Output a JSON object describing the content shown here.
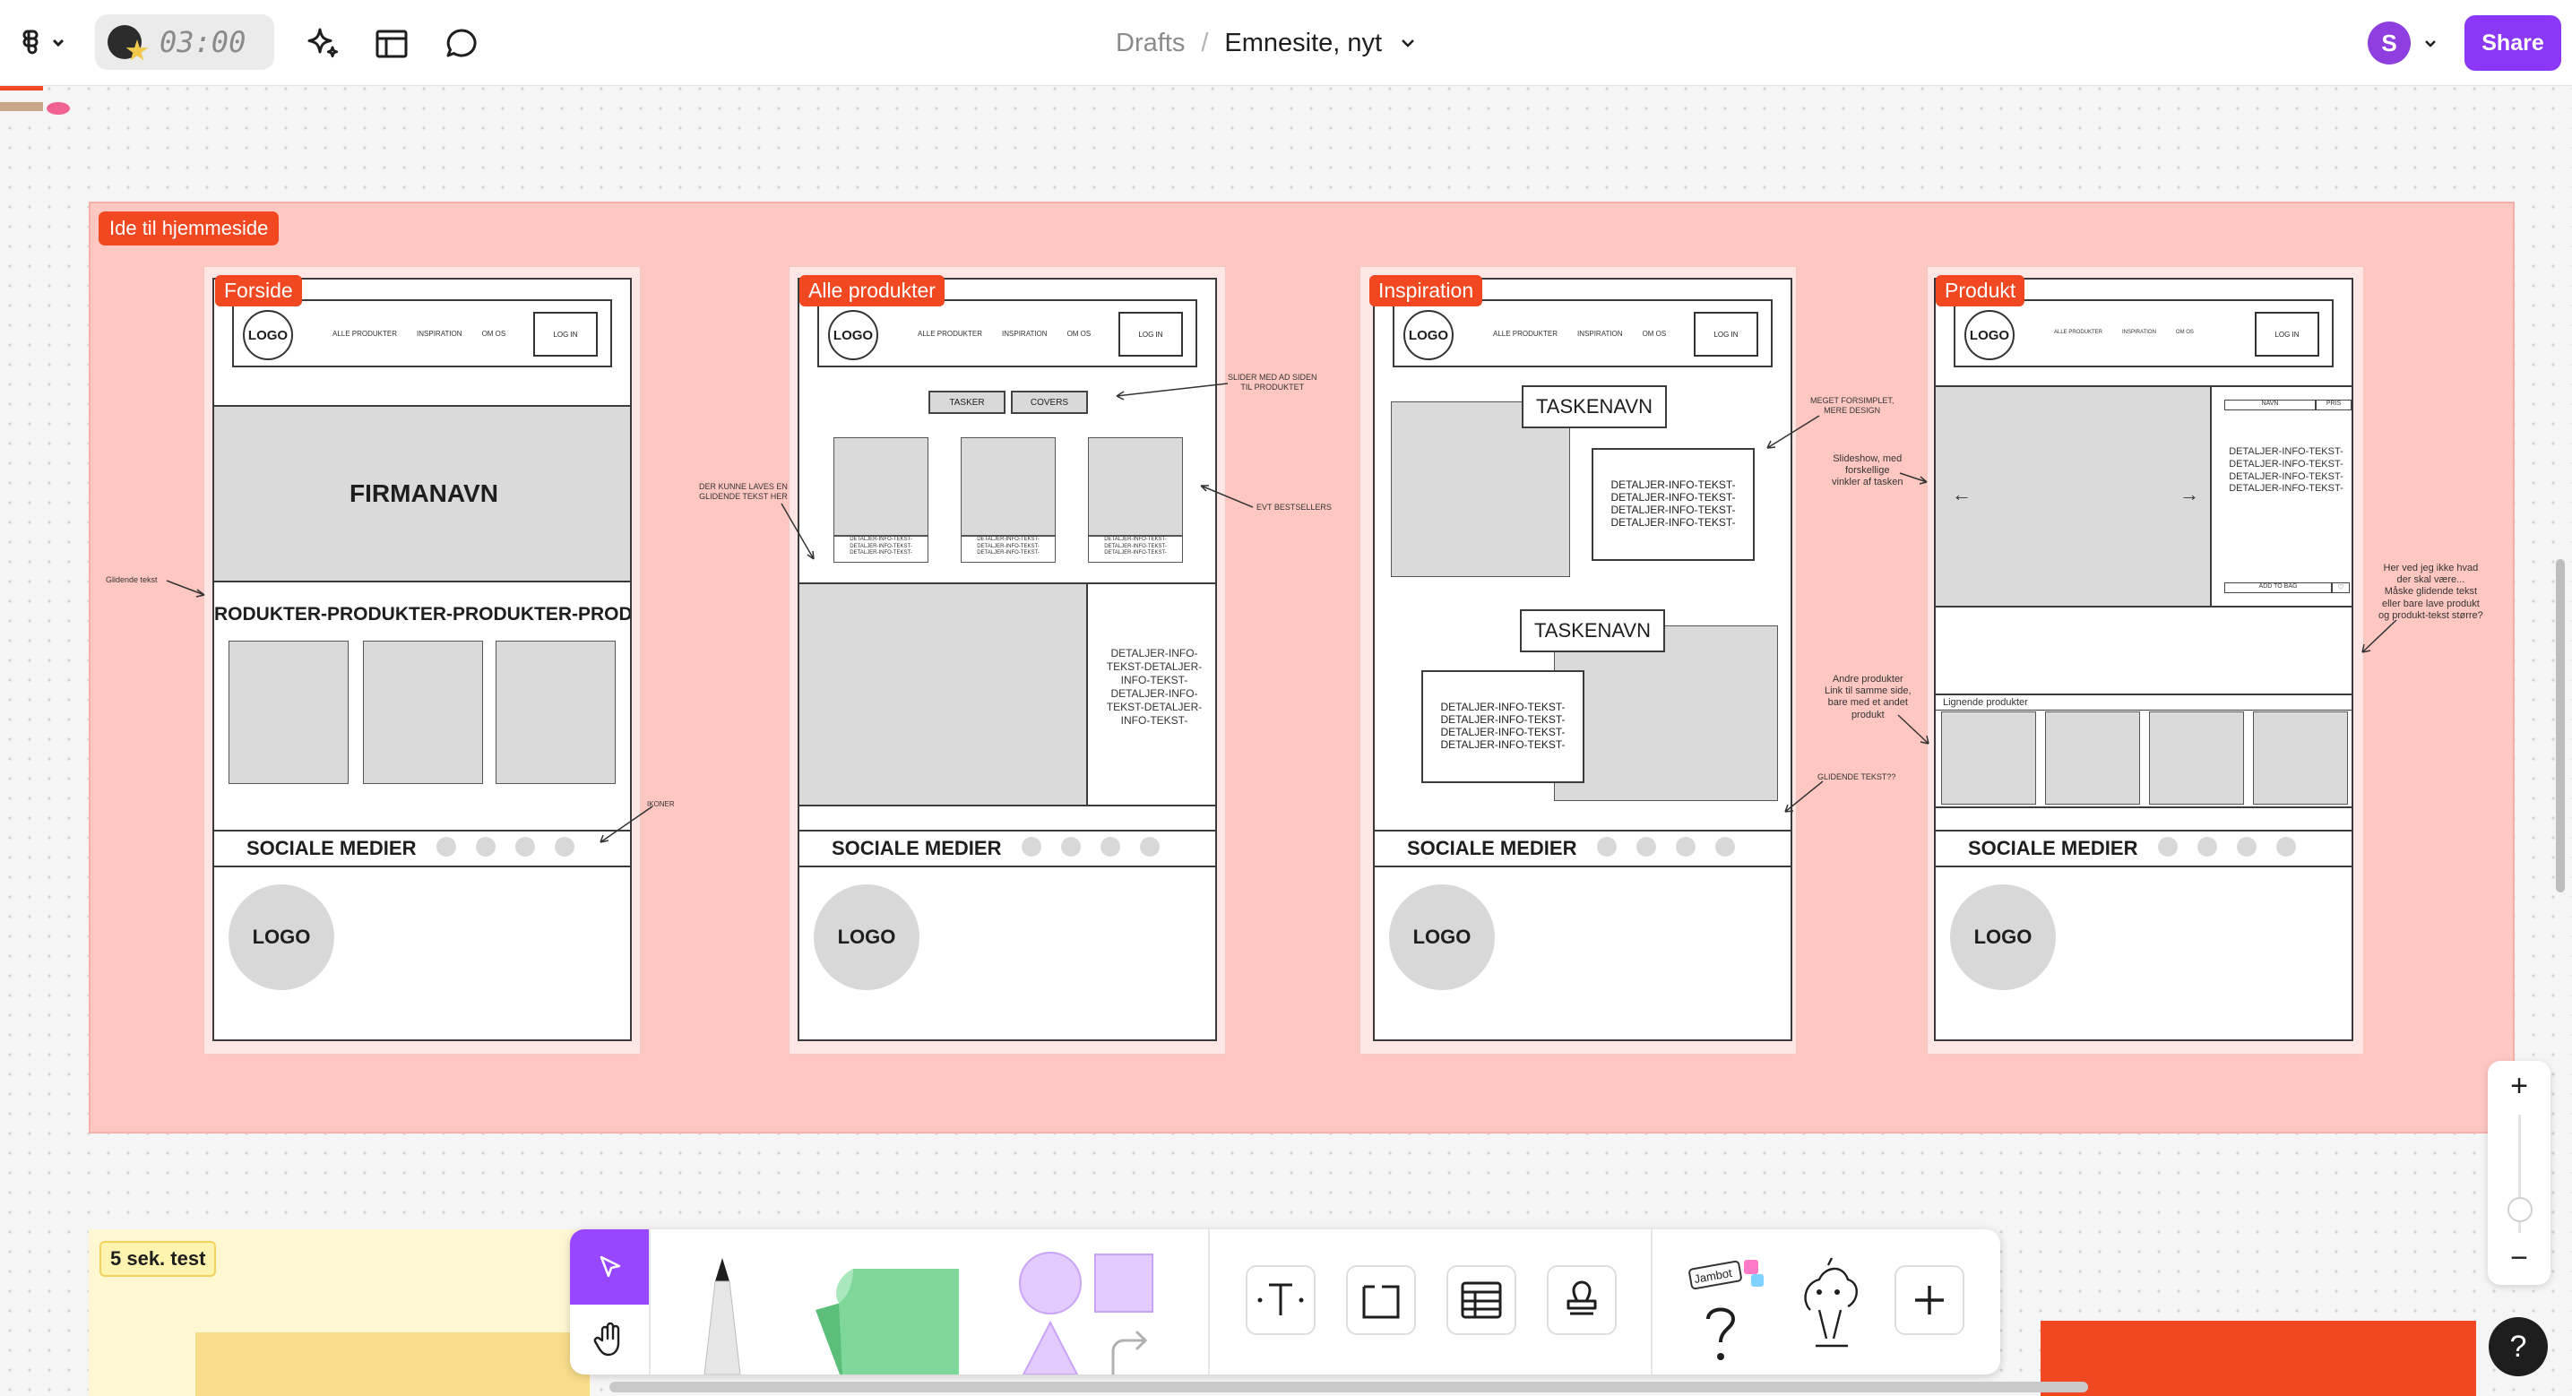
{
  "topbar": {
    "timer": "03:00",
    "breadcrumb": {
      "parent": "Drafts",
      "separator": "/",
      "file": "Emnesite, nyt"
    },
    "avatar_initial": "S",
    "share_label": "Share",
    "icons": [
      "figma-menu-icon",
      "sparkle-ai-icon",
      "layout-icon",
      "comment-icon",
      "chevron-down-icon"
    ]
  },
  "section": {
    "label": "Ide til hjemmeside",
    "color": "#ffc7c2"
  },
  "frames": {
    "forside": {
      "label": "Forside",
      "logo": "LOGO",
      "nav_links": [
        "ALLE PRODUKTER",
        "INSPIRATION",
        "OM OS"
      ],
      "login": "LOG IN",
      "hero_title": "FIRMANAVN",
      "marquee": "RODUKTER-PRODUKTER-PRODUKTER-PROD",
      "social": "SOCIALE MEDIER",
      "footer_logo": "LOGO"
    },
    "alle": {
      "label": "Alle produkter",
      "logo": "LOGO",
      "nav_links": [
        "ALLE PRODUKTER",
        "INSPIRATION",
        "OM OS"
      ],
      "login": "LOG IN",
      "filters": [
        "TASKER",
        "COVERS"
      ],
      "product_caption": "DETALJER-INFO-TEKST-\nDETALJER-INFO-TEKST-\nDETALJER-INFO-TEKST-",
      "detail_text": "DETALJER-INFO-\nTEKST-DETALJER-\nINFO-TEKST-\nDETALJER-INFO-\nTEKST-DETALJER-\nINFO-TEKST-",
      "social": "SOCIALE MEDIER",
      "footer_logo": "LOGO"
    },
    "inspiration": {
      "label": "Inspiration",
      "logo": "LOGO",
      "nav_links": [
        "ALLE PRODUKTER",
        "INSPIRATION",
        "OM OS"
      ],
      "login": "LOG IN",
      "bag_name_1": "TASKENAVN",
      "bag_name_2": "TASKENAVN",
      "detail_text": "DETALJER-INFO-TEKST-\nDETALJER-INFO-TEKST-\nDETALJER-INFO-TEKST-\nDETALJER-INFO-TEKST-",
      "social": "SOCIALE MEDIER",
      "footer_logo": "LOGO"
    },
    "produkt": {
      "label": "Produkt",
      "logo": "LOGO",
      "nav_links": [
        "ALLE PRODUKTER",
        "INSPIRATION",
        "OM OS"
      ],
      "login": "LOG IN",
      "name_col": "NAVN",
      "price_col": "PRIS",
      "detail_text": "DETALJER-INFO-TEKST-\nDETALJER-INFO-TEKST-\nDETALJER-INFO-TEKST-\nDETALJER-INFO-TEKST-",
      "add_to_bag": "ADD TO BAG",
      "similar": "Lignende produkter",
      "social": "SOCIALE MEDIER",
      "footer_logo": "LOGO"
    }
  },
  "annotations": {
    "glidende_tekst": "Glidende tekst",
    "ikoner": "IKONER",
    "kunne_laves": "DER KUNNE LAVES EN\nGLIDENDE TEKST HER",
    "slider": "SLIDER MED AD SIDEN\nTIL PRODUKTET",
    "bestsellers": "EVT BESTSELLERS",
    "forsimplet": "MEGET FORSIMPLET,\nMERE DESIGN",
    "slideshow": "Slideshow, med\nforskellige\nvinkler af tasken",
    "andre": "Andre produkter\nLink til samme side,\nbare med et andet\nprodukt",
    "glidende_2": "GLIDENDE TEKST??",
    "her_ved": "Her ved jeg ikke hvad\nder skal være...\nMåske glidende tekst\neller bare lave produkt\nog produkt-tekst større?"
  },
  "bottom": {
    "sticky_label": "5 sek. test",
    "toolbar_tools": [
      "move-tool",
      "hand-tool",
      "pen-tool",
      "sticky-note-tool",
      "shapes-tool",
      "text-tool",
      "section-tool",
      "table-tool",
      "stamp-tool",
      "widgets-tool",
      "add-tool"
    ],
    "jambot_label": "Jambot",
    "zoom_plus": "+",
    "zoom_minus": "−",
    "help": "?"
  },
  "colors": {
    "accent": "#9747ff",
    "share": "#8a38f5",
    "section_label": "#f24822",
    "sticky_green": "#7fd89a"
  }
}
